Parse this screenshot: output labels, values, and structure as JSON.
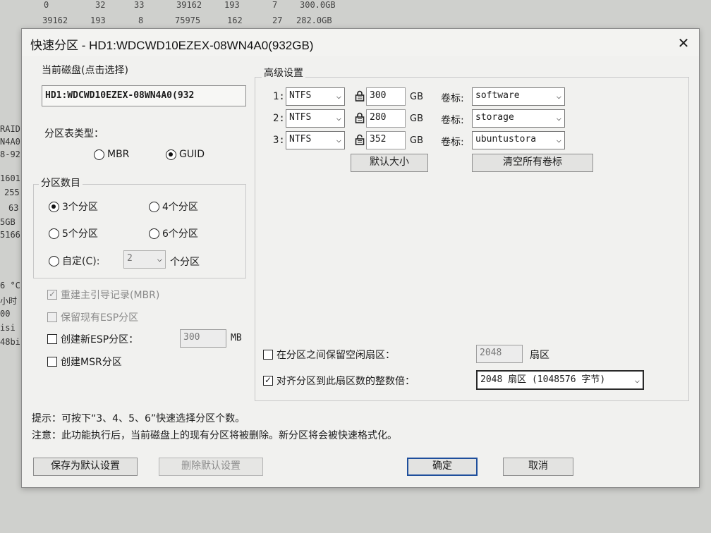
{
  "background": {
    "rows": [
      [
        "0",
        "32",
        "33",
        "39162",
        "193",
        "7",
        "300.0GB"
      ],
      [
        "39162",
        "193",
        "8",
        "75975",
        "162",
        "27",
        "282.0GB"
      ]
    ],
    "left_fragments": [
      "RAID",
      "N4A0",
      "8-92",
      "1601",
      "255",
      "63",
      "5GB",
      "5166",
      "6 °C",
      "小时",
      "00",
      "isi",
      "48bi"
    ]
  },
  "dialog": {
    "title": "快速分区 - HD1:WDCWD10EZEX-08WN4A0(932GB)",
    "current_disk": {
      "label": "当前磁盘(点击选择)",
      "value": "HD1:WDCWD10EZEX-08WN4A0(932"
    },
    "partition_table": {
      "label": "分区表类型：",
      "options": [
        "MBR",
        "GUID"
      ],
      "selected": "GUID"
    },
    "partition_count": {
      "label": "分区数目",
      "options": [
        "3个分区",
        "4个分区",
        "5个分区",
        "6个分区"
      ],
      "selected": "3个分区",
      "custom_label": "自定(C):",
      "custom_value": "2",
      "custom_suffix": "个分区"
    },
    "options": {
      "rebuild_mbr": "重建主引导记录(MBR)",
      "keep_esp": "保留现有ESP分区",
      "new_esp": "创建新ESP分区：",
      "new_esp_size": "300",
      "new_esp_unit": "MB",
      "create_msr": "创建MSR分区"
    },
    "advanced": {
      "label": "高级设置",
      "partitions": [
        {
          "index": "1:",
          "fs": "NTFS",
          "size": "300",
          "unit": "GB",
          "vol_label_text": "卷标:",
          "volume": "software",
          "locked": true
        },
        {
          "index": "2:",
          "fs": "NTFS",
          "size": "280",
          "unit": "GB",
          "vol_label_text": "卷标:",
          "volume": "storage",
          "locked": true
        },
        {
          "index": "3:",
          "fs": "NTFS",
          "size": "352",
          "unit": "GB",
          "vol_label_text": "卷标:",
          "volume": "ubuntustora",
          "locked": false
        }
      ],
      "default_size_button": "默认大小",
      "clear_labels_button": "清空所有卷标",
      "reserve_free": "在分区之间保留空闲扇区：",
      "reserve_value": "2048",
      "reserve_unit": "扇区",
      "align": "对齐分区到此扇区数的整数倍：",
      "align_value": "2048 扇区 (1048576 字节)"
    },
    "hint": "提示：可按下“3、4、5、6”快速选择分区个数。",
    "note": "注意：此功能执行后，当前磁盘上的现有分区将被删除。新分区将会被快速格式化。",
    "buttons": {
      "save_default": "保存为默认设置",
      "delete_default": "删除默认设置",
      "ok": "确定",
      "cancel": "取消"
    }
  }
}
